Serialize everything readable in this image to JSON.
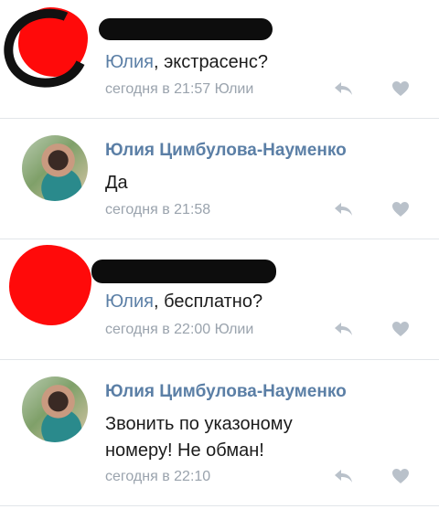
{
  "comments": [
    {
      "author": "",
      "reply_name": "Юлия",
      "text": ", экстрасенс?",
      "timestamp": "сегодня в 21:57",
      "reply_suffix": " Юлии"
    },
    {
      "author": "Юлия Цимбулова-Науменко",
      "text": "Да",
      "timestamp": "сегодня в 21:58"
    },
    {
      "author": "",
      "reply_name": "Юлия",
      "text": ", бесплатно?",
      "timestamp": "сегодня в 22:00",
      "reply_suffix": " Юлии"
    },
    {
      "author": "Юлия Цимбулова-Науменко",
      "text_lines": [
        "Звонить по указоному",
        "номеру! Не обман!"
      ],
      "timestamp": "сегодня в 22:10"
    }
  ],
  "icons": {
    "reply": "reply-arrow-icon",
    "like": "heart-icon"
  },
  "colors": {
    "link": "#5b7fa6",
    "meta": "#9aa3ad",
    "icon": "#b9c1ca",
    "divider": "#e2e5e9"
  }
}
